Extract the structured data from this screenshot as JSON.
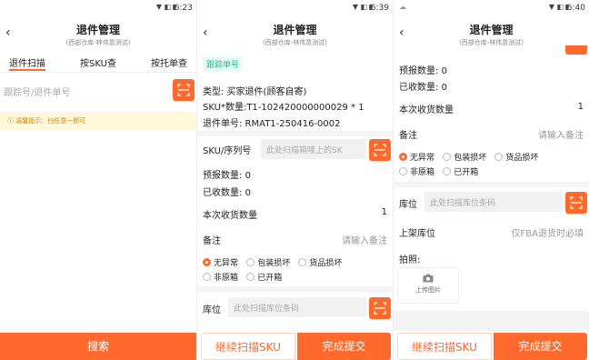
{
  "status": {
    "p1_time": "6:23",
    "p2_time": "6:39",
    "p3_time": "6:40"
  },
  "header": {
    "title": "退件管理",
    "subtitle": "(西部仓库-林伟意测试)"
  },
  "p1": {
    "tabs": [
      "退件扫描",
      "按SKU查",
      "按托单查"
    ],
    "search_placeholder": "跟踪号/退件单号",
    "tip": "温馨提示：扫任意一即可",
    "search_button": "搜索"
  },
  "p2": {
    "badge": "跟踪单号",
    "type_line": "类型: 买家退件(顾客自寄)",
    "sku_line": "SKU*数量:T1-102420000000029 * 1",
    "return_no": "退件单号: RMAT1-250416-0002",
    "sku_label": "SKU/序列号",
    "sku_placeholder": "此处扫描箱唛上的SK",
    "forecast_label": "预报数量:",
    "forecast_value": "0",
    "received_label": "已收数量:",
    "received_value": "0",
    "this_qty_label": "本次收货数量",
    "this_qty_value": "1",
    "remark_label": "备注",
    "remark_placeholder": "请输入备注",
    "radios": [
      "无异常",
      "包装损坏",
      "货品损坏",
      "非原箱",
      "已开箱"
    ],
    "location_label": "库位",
    "location_placeholder": "此处扫描库位条码",
    "continue_button": "继续扫描SKU",
    "submit_button": "完成提交"
  },
  "p3": {
    "forecast_label": "预报数量:",
    "forecast_value": "0",
    "received_label": "已收数量:",
    "received_value": "0",
    "this_qty_label": "本次收货数量",
    "this_qty_value": "1",
    "remark_label": "备注",
    "remark_placeholder": "请输入备注",
    "radios": [
      "无异常",
      "包装损坏",
      "货品损坏",
      "非原箱",
      "已开箱"
    ],
    "location_label": "库位",
    "location_placeholder": "此处扫描库位条码",
    "shelf_label": "上架库位",
    "shelf_placeholder": "仅FBA退货时必填",
    "photo_label": "拍照:",
    "upload_label": "上传图片",
    "continue_button": "继续扫描SKU",
    "submit_button": "完成提交"
  },
  "colors": {
    "accent": "#ff6a2c",
    "badge": "#20b98a"
  }
}
